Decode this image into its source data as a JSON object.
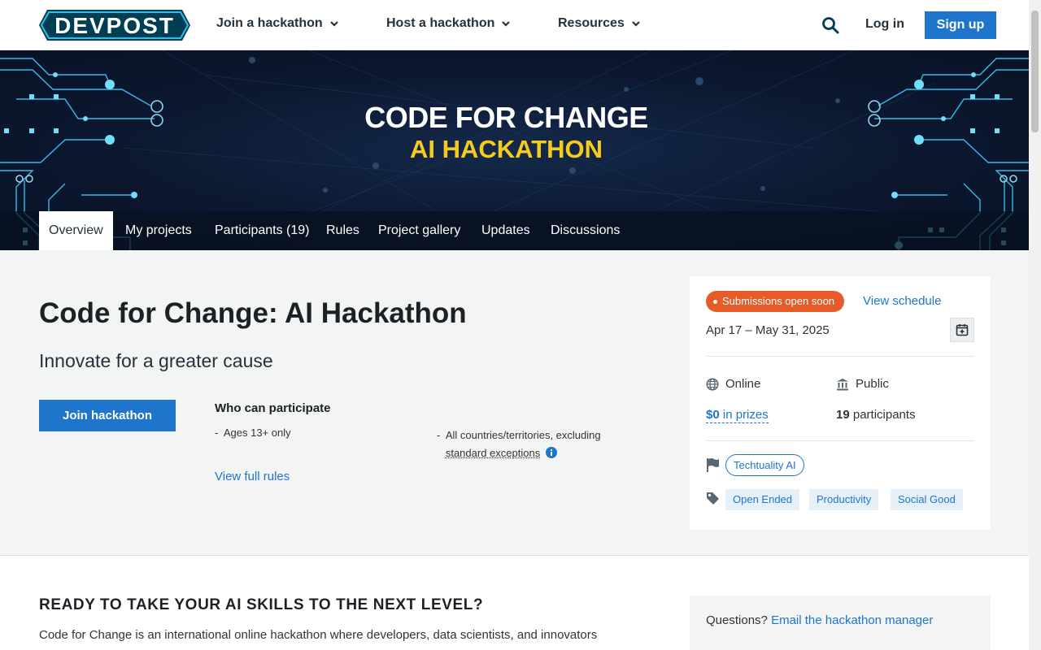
{
  "header": {
    "logo_text": "DEVPOST",
    "nav": [
      {
        "label": "Join a hackathon"
      },
      {
        "label": "Host a hackathon"
      },
      {
        "label": "Resources"
      }
    ],
    "login": "Log in",
    "signup": "Sign up"
  },
  "banner": {
    "title": "CODE FOR CHANGE",
    "subtitle": "AI HACKATHON"
  },
  "tabs": [
    {
      "label": "Overview"
    },
    {
      "label": "My projects"
    },
    {
      "label": "Participants (19)"
    },
    {
      "label": "Rules"
    },
    {
      "label": "Project gallery"
    },
    {
      "label": "Updates"
    },
    {
      "label": "Discussions"
    }
  ],
  "main": {
    "title": "Code for Change: AI Hackathon",
    "tagline": "Innovate for a greater cause",
    "join_button": "Join hackathon",
    "who_heading": "Who can participate",
    "eligibility_age": "Ages 13+ only",
    "eligibility_countries": "All countries/territories, excluding",
    "exceptions_link": "standard exceptions",
    "rules_link": "View full rules"
  },
  "card": {
    "status_badge": "Submissions open soon",
    "schedule_link": "View schedule",
    "dates": "Apr 17 – May 31, 2025",
    "location": "Online",
    "visibility": "Public",
    "prize_amount": "$0",
    "prize_suffix": "in prizes",
    "participant_count": "19",
    "participant_suffix": "participants",
    "host": "Techtuality AI",
    "tags": [
      "Open Ended",
      "Productivity",
      "Social Good"
    ]
  },
  "lower": {
    "heading": "READY TO TAKE YOUR AI SKILLS TO THE NEXT LEVEL?",
    "intro": "Code for Change is an international online hackathon where developers, data scientists, and innovators",
    "question": "Questions?",
    "email_link": "Email the hackathon manager"
  },
  "colors": {
    "brand_blue": "#1f75cc",
    "badge_orange": "#e65b28",
    "banner_yellow": "#f5cc1e",
    "logo_teal": "#003e54"
  }
}
